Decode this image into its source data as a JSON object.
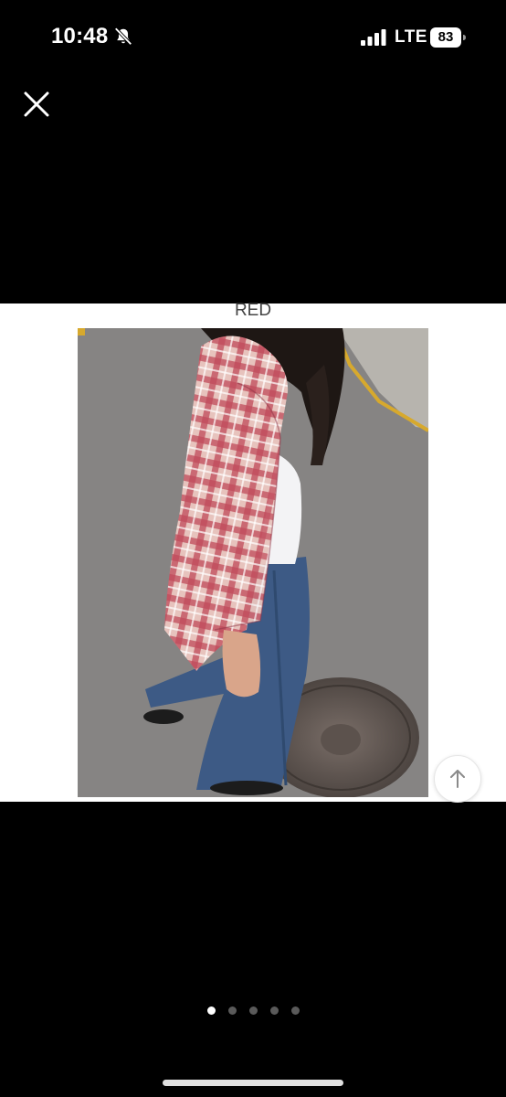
{
  "status_bar": {
    "time": "10:48",
    "network": "LTE",
    "battery": "83",
    "icons": [
      "bell-slash-icon",
      "signal-bars-icon",
      "battery-icon"
    ]
  },
  "viewer": {
    "close_icon": "close-icon",
    "caption": "RED",
    "photo_subject": "checked shirt outfit on street",
    "scroll_top_icon": "arrow-up-icon"
  },
  "pagination": {
    "total": 5,
    "active_index": 0
  },
  "colors": {
    "background": "#000000",
    "panel": "#ffffff",
    "dot_active": "#ffffff",
    "dot_inactive": "#5a5a5a"
  }
}
